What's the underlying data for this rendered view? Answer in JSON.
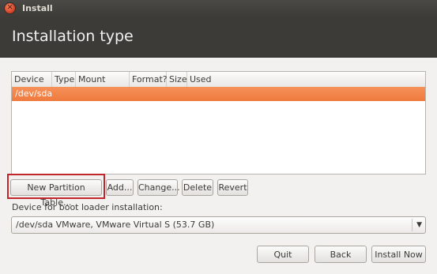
{
  "window": {
    "title": "Install"
  },
  "page": {
    "title": "Installation type"
  },
  "table": {
    "columns": [
      "Device",
      "Type",
      "Mount point",
      "Format?",
      "Size",
      "Used"
    ],
    "rows": [
      [
        "/dev/sda",
        "",
        "",
        "",
        "",
        ""
      ]
    ]
  },
  "partition_buttons": {
    "new_table": "New Partition Table...",
    "add": "Add...",
    "change": "Change...",
    "delete": "Delete",
    "revert": "Revert"
  },
  "bootloader": {
    "label": "Device for boot loader installation:",
    "selected": "/dev/sda  VMware, VMware Virtual S (53.7 GB)"
  },
  "footer": {
    "quit": "Quit",
    "back": "Back",
    "install_now": "Install Now"
  },
  "colors": {
    "selection": "#ef7a3d",
    "header_bg": "#3c3b37",
    "highlight": "#c0262c"
  }
}
